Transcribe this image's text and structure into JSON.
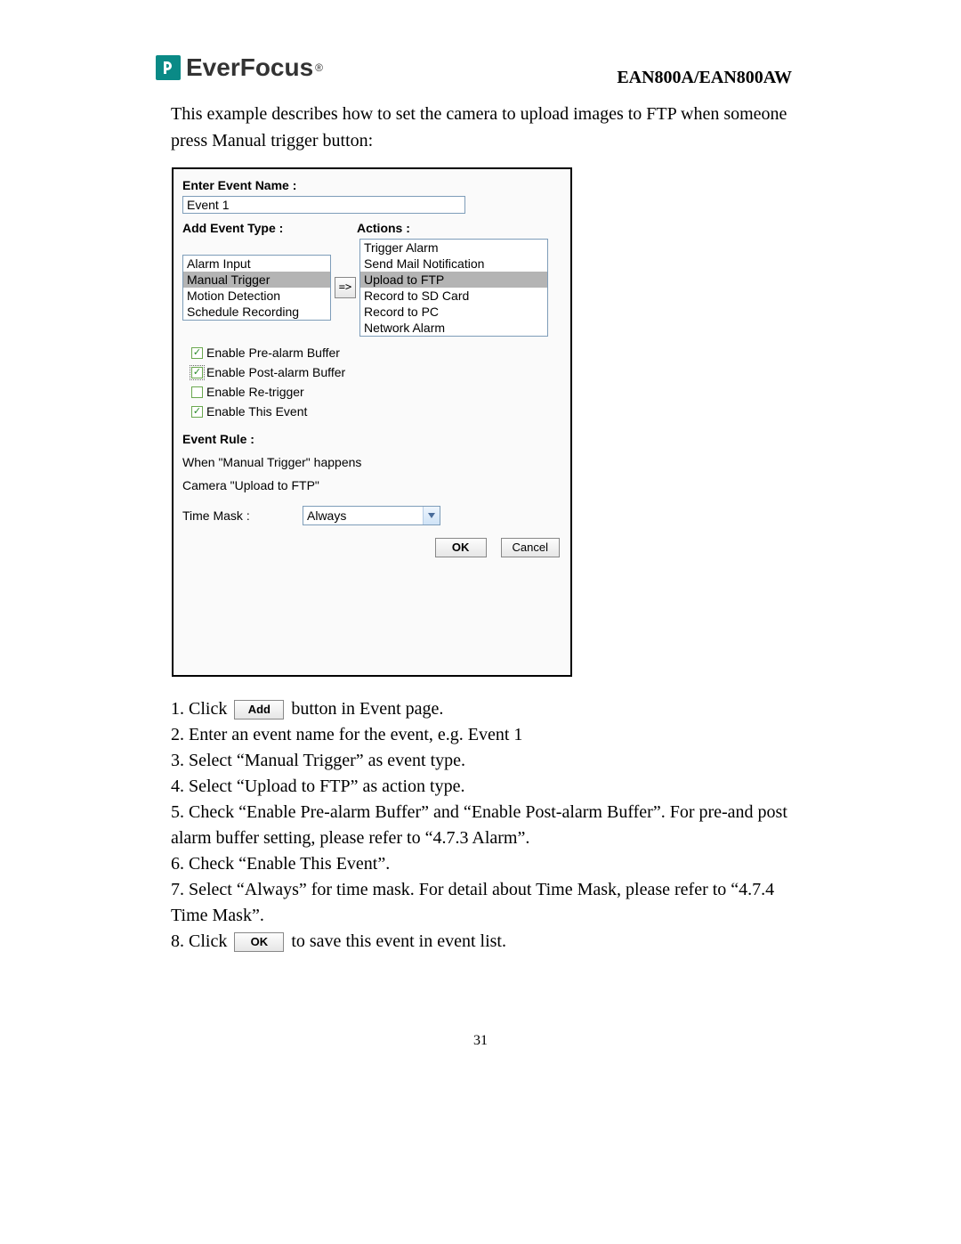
{
  "header": {
    "logo_text": "EverFocus",
    "model": "EAN800A/EAN800AW"
  },
  "intro": "This example describes how to set the camera to upload images to FTP when someone press Manual trigger button:",
  "panel": {
    "enter_event_name_label": "Enter Event Name :",
    "event_name_value": "Event 1",
    "add_event_type_label": "Add Event Type :",
    "actions_label": "Actions :",
    "arrow_label": "=>",
    "event_types": [
      {
        "label": "Alarm Input",
        "selected": false
      },
      {
        "label": "Manual Trigger",
        "selected": true
      },
      {
        "label": "Motion Detection",
        "selected": false
      },
      {
        "label": "Schedule Recording",
        "selected": false
      }
    ],
    "actions": [
      {
        "label": "Trigger Alarm",
        "selected": false
      },
      {
        "label": "Send Mail Notification",
        "selected": false
      },
      {
        "label": "Upload to FTP",
        "selected": true
      },
      {
        "label": "Record to SD Card",
        "selected": false
      },
      {
        "label": "Record to PC",
        "selected": false
      },
      {
        "label": "Network Alarm",
        "selected": false
      }
    ],
    "checks": {
      "pre": {
        "label": "Enable Pre-alarm Buffer",
        "checked": true,
        "focused": false
      },
      "post": {
        "label": "Enable Post-alarm Buffer",
        "checked": true,
        "focused": true
      },
      "retrig": {
        "label": "Enable Re-trigger",
        "checked": false,
        "focused": false
      },
      "this": {
        "label": "Enable This Event",
        "checked": true,
        "focused": false
      }
    },
    "event_rule_label": "Event Rule :",
    "event_rule_line1": "When \"Manual Trigger\" happens",
    "event_rule_line2": "Camera \"Upload to FTP\"",
    "time_mask_label": "Time Mask :",
    "time_mask_value": "Always",
    "ok_label": "OK",
    "cancel_label": "Cancel"
  },
  "steps": {
    "s1a": "1. Click",
    "s1_btn": "Add",
    "s1b": "button in Event page.",
    "s2": "2. Enter an event name for the event, e.g. Event 1",
    "s3": "3. Select “Manual Trigger” as event type.",
    "s4": "4. Select “Upload to FTP” as action type.",
    "s5": "5. Check “Enable Pre-alarm Buffer” and “Enable Post-alarm Buffer”. For pre-and post alarm buffer setting, please refer to “4.7.3 Alarm”.",
    "s6": "6. Check “Enable This Event”.",
    "s7": "7. Select “Always” for time mask. For detail about Time Mask, please refer to “4.7.4 Time Mask”.",
    "s8a": "8. Click",
    "s8_btn": "OK",
    "s8b": "to save this event in event list."
  },
  "page_number": "31"
}
